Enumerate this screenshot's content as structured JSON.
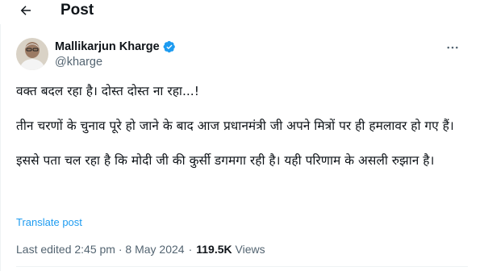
{
  "header": {
    "title": "Post"
  },
  "post": {
    "author": {
      "name": "Mallikarjun Kharge",
      "handle": "@kharge",
      "verified": true
    },
    "paragraphs": [
      "वक्त बदल रहा है। दोस्त दोस्त ना रहा...!",
      "तीन चरणों के चुनाव पूरे हो जाने के बाद आज प्रधानमंत्री जी अपने मित्रों पर ही हमलावर हो गए हैं।",
      "इससे पता चल रहा है कि मोदी जी की कुर्सी डगमगा रही है। यही परिणाम के असली रुझान है।"
    ],
    "translate_label": "Translate post",
    "meta": {
      "edited_label": "Last edited 2:45 pm · 8 May 2024",
      "separator": "·",
      "views_count": "119.5K",
      "views_label": "Views"
    }
  },
  "colors": {
    "text": "#0f1419",
    "secondary": "#536471",
    "link": "#1d9bf0",
    "verified": "#1d9bf0"
  },
  "icons": {
    "back": "arrow-left-icon",
    "verified": "verified-badge-icon",
    "more": "more-horizontal-icon"
  }
}
